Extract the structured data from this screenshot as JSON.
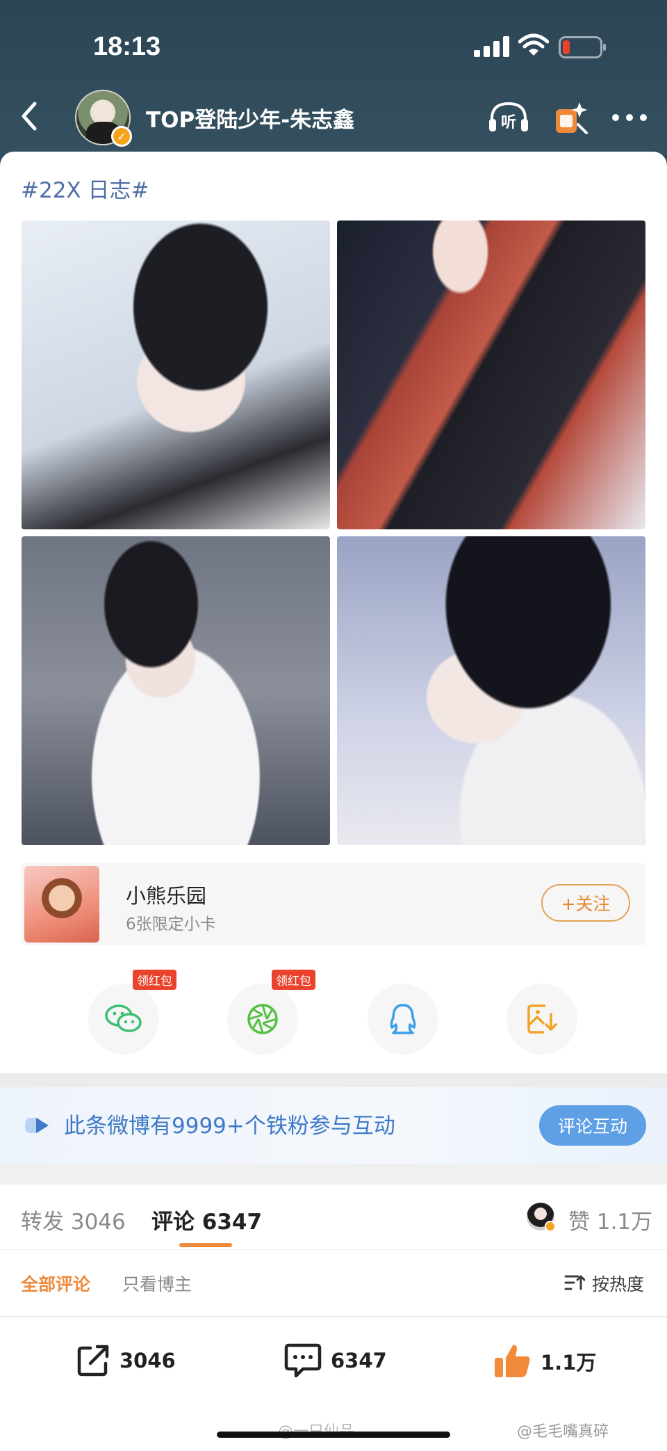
{
  "status_bar": {
    "time": "18:13"
  },
  "header": {
    "account_name": "TOP登陆少年-朱志鑫",
    "verified_mark": "✓"
  },
  "post": {
    "hashtag": "#22X 日志#",
    "photos": [
      "photo-1",
      "photo-2",
      "photo-3",
      "photo-4"
    ]
  },
  "sticker_card": {
    "title": "小熊乐园",
    "subtitle": "6张限定小卡",
    "follow_label": "+关注"
  },
  "share": {
    "redpacket_label": "领红包",
    "items": [
      "wechat-icon",
      "moments-icon",
      "qq-icon",
      "save-image-icon"
    ]
  },
  "interact_banner": {
    "text": "此条微博有9999+个铁粉参与互动",
    "button_label": "评论互动"
  },
  "tabs": {
    "repost": "转发 3046",
    "comment": "评论 6347",
    "like": "赞 1.1万"
  },
  "filters": {
    "all": "全部评论",
    "owner_only": "只看博主",
    "sort": "按热度"
  },
  "action_bar": {
    "repost_count": "3046",
    "comment_count": "6347",
    "like_count": "1.1万"
  },
  "watermarks": {
    "left": "@一只仙品",
    "right": "@毛毛嘴真碎"
  },
  "colors": {
    "header_bg": "#2f4a5c",
    "accent_orange": "#f08a3b",
    "link_blue": "#4d6fa6",
    "interact_blue": "#5f9fe6",
    "redpacket_red": "#e9432e",
    "battery_low": "#e9432e"
  }
}
